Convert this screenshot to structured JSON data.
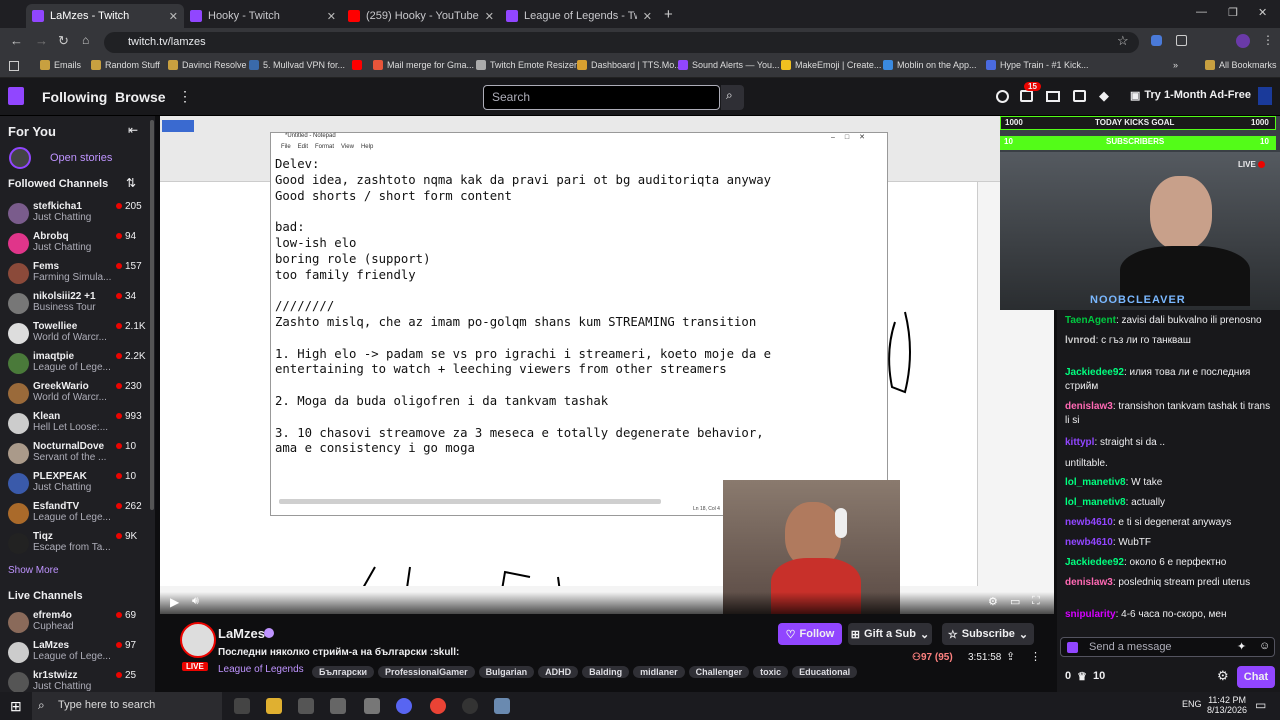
{
  "tabs": [
    {
      "title": "LaMzes - Twitch",
      "color": "#9146ff"
    },
    {
      "title": "Hooky - Twitch",
      "color": "#9146ff"
    },
    {
      "title": "(259) Hooky - YouTube",
      "color": "#ff0000"
    },
    {
      "title": "League of Legends - Twitch",
      "color": "#9146ff"
    }
  ],
  "url": "twitch.tv/lamzes",
  "bookmarks": [
    "Emails",
    "Random Stuff",
    "Davinci Resolve",
    "5. Mullvad VPN for...",
    "",
    "Mail merge for Gma...",
    "Twitch Emote Resizer",
    "Dashboard | TTS.Mo...",
    "Sound Alerts — You...",
    "MakeEmoji | Create...",
    "Moblin on the App...",
    "Hype Train - #1 Kick...",
    "All Bookmarks"
  ],
  "nav": {
    "following": "Following",
    "browse": "Browse",
    "search_placeholder": "Search",
    "notif_count": "15",
    "ad_free": "Try 1-Month Ad-Free"
  },
  "sidebar": {
    "for_you": "For You",
    "open_stories": "Open stories",
    "followed": "Followed Channels",
    "show_more": "Show More",
    "live": "Live Channels",
    "channels": [
      {
        "name": "stefkicha1",
        "game": "Just Chatting",
        "viewers": "205",
        "color": "#7a5c8c"
      },
      {
        "name": "Abrobq",
        "game": "Just Chatting",
        "viewers": "94",
        "color": "#e0358a"
      },
      {
        "name": "Fems",
        "game": "Farming Simula...",
        "viewers": "157",
        "color": "#8b4a3a"
      },
      {
        "name": "nikolsiii22 +1",
        "game": "Business Tour",
        "viewers": "34",
        "color": "#777"
      },
      {
        "name": "Towelliee",
        "game": "World of Warcr...",
        "viewers": "2.1K",
        "color": "#ddd"
      },
      {
        "name": "imaqtpie",
        "game": "League of Lege...",
        "viewers": "2.2K",
        "color": "#4a7a3a"
      },
      {
        "name": "GreekWario",
        "game": "World of Warcr...",
        "viewers": "230",
        "color": "#9a6a3a"
      },
      {
        "name": "Klean",
        "game": "Hell Let Loose:...",
        "viewers": "993",
        "color": "#ccc"
      },
      {
        "name": "NocturnalDove",
        "game": "Servant of the ...",
        "viewers": "10",
        "color": "#aa9a8a"
      },
      {
        "name": "PLEXPEAK",
        "game": "Just Chatting",
        "viewers": "10",
        "color": "#3a5aaa"
      },
      {
        "name": "EsfandTV",
        "game": "League of Lege...",
        "viewers": "262",
        "color": "#aa6a2a"
      },
      {
        "name": "Tiqz",
        "game": "Escape from Ta...",
        "viewers": "9K",
        "color": "#222"
      }
    ],
    "live_channels": [
      {
        "name": "efrem4o",
        "game": "Cuphead",
        "viewers": "69",
        "color": "#8a6a5a"
      },
      {
        "name": "LaMzes",
        "game": "League of Lege...",
        "viewers": "97",
        "color": "#ccc"
      },
      {
        "name": "kr1stwizz",
        "game": "Just Chatting",
        "viewers": "25",
        "color": "#555"
      }
    ]
  },
  "notepad": {
    "title": "*Untitled - Notepad",
    "menu": [
      "File",
      "Edit",
      "Format",
      "View",
      "Help"
    ],
    "status": "Ln 18, Col 4",
    "text": "Delev:\nGood idea, zashtoto nqma kak da pravi pari ot bg auditoriqta anyway\nGood shorts / short form content\n\nbad:\nlow-ish elo\nboring role (support)\ntoo family friendly\n\n////////\nZashto mislq, che az imam po-golqm shans kum STREAMING transition\n\n1. High elo -> padam se vs pro igrachi i streameri, koeto moje da e\nentertaining to watch + leeching viewers from other streamers\n\n2. Moga da buda oligofren i da tankvam tashak\n\n3. 10 chasovi streamove za 3 meseca e totally degenerate behavior,\nama e consistency i go moga"
  },
  "overlay": {
    "goal_left": "1000",
    "goal_label": "TODAY KICKS GOAL",
    "goal_right": "1000",
    "sub_left": "10",
    "sub_label": "SUBSCRIBERS",
    "sub_right": "10",
    "live": "LIVE",
    "name": "NOOBCLEAVER"
  },
  "chat": [
    {
      "user": "TaenAgent",
      "color": "#00c840",
      "text": ": zavisi dali bukvalno ili prenosno"
    },
    {
      "user": "lvnrod",
      "color": "#c8c8c8",
      "text": ": с гъз ли го танкваш"
    },
    {
      "user": "Jackiedee92",
      "color": "#00ff7f",
      "text": ": илия това ли е последния стрийм"
    },
    {
      "user": "denislaw3",
      "color": "#ff69b4",
      "text": ": transishon tankvam tashak ti trans li si"
    },
    {
      "user": "kittypl",
      "color": "#9146ff",
      "text": ": straight si da .."
    },
    {
      "user": "",
      "color": "#c8c8c8",
      "text": "untiltable."
    },
    {
      "user": "lol_manetiv8",
      "color": "#00ff7f",
      "text": ": W take"
    },
    {
      "user": "lol_manetiv8",
      "color": "#00ff7f",
      "text": ": actually"
    },
    {
      "user": "newb4610",
      "color": "#9146ff",
      "text": ": e ti si degenerat anyways"
    },
    {
      "user": "newb4610",
      "color": "#9146ff",
      "text": ": WubTF"
    },
    {
      "user": "Jackiedee92",
      "color": "#00ff7f",
      "text": ": около 6 е перфектно"
    },
    {
      "user": "denislaw3",
      "color": "#ff69b4",
      "text": ": posledniq stream predi uterus"
    },
    {
      "user": "snipularity",
      "color": "#d400ff",
      "text": ": 4-6 часа по-скоро, мен"
    }
  ],
  "chat_input": {
    "placeholder": "Send a message",
    "points": "0",
    "bits": "10",
    "chat_button": "Chat"
  },
  "stream_info": {
    "channel": "LaMzes",
    "title": "Последни няколко стрийм-а на български :skull:",
    "game": "League of Legends",
    "viewers": "97 (95)",
    "uptime": "3:51:58",
    "follow": "Follow",
    "gift": "Gift a Sub",
    "subscribe": "Subscribe",
    "live": "LIVE",
    "tags": [
      "Български",
      "ProfessionalGamer",
      "Bulgarian",
      "ADHD",
      "Balding",
      "midlaner",
      "Challenger",
      "toxic",
      "Educational"
    ]
  },
  "taskbar": {
    "search": "Type here to search",
    "lang": "ENG",
    "time": "11:42 PM",
    "date": "8/13/2026"
  }
}
